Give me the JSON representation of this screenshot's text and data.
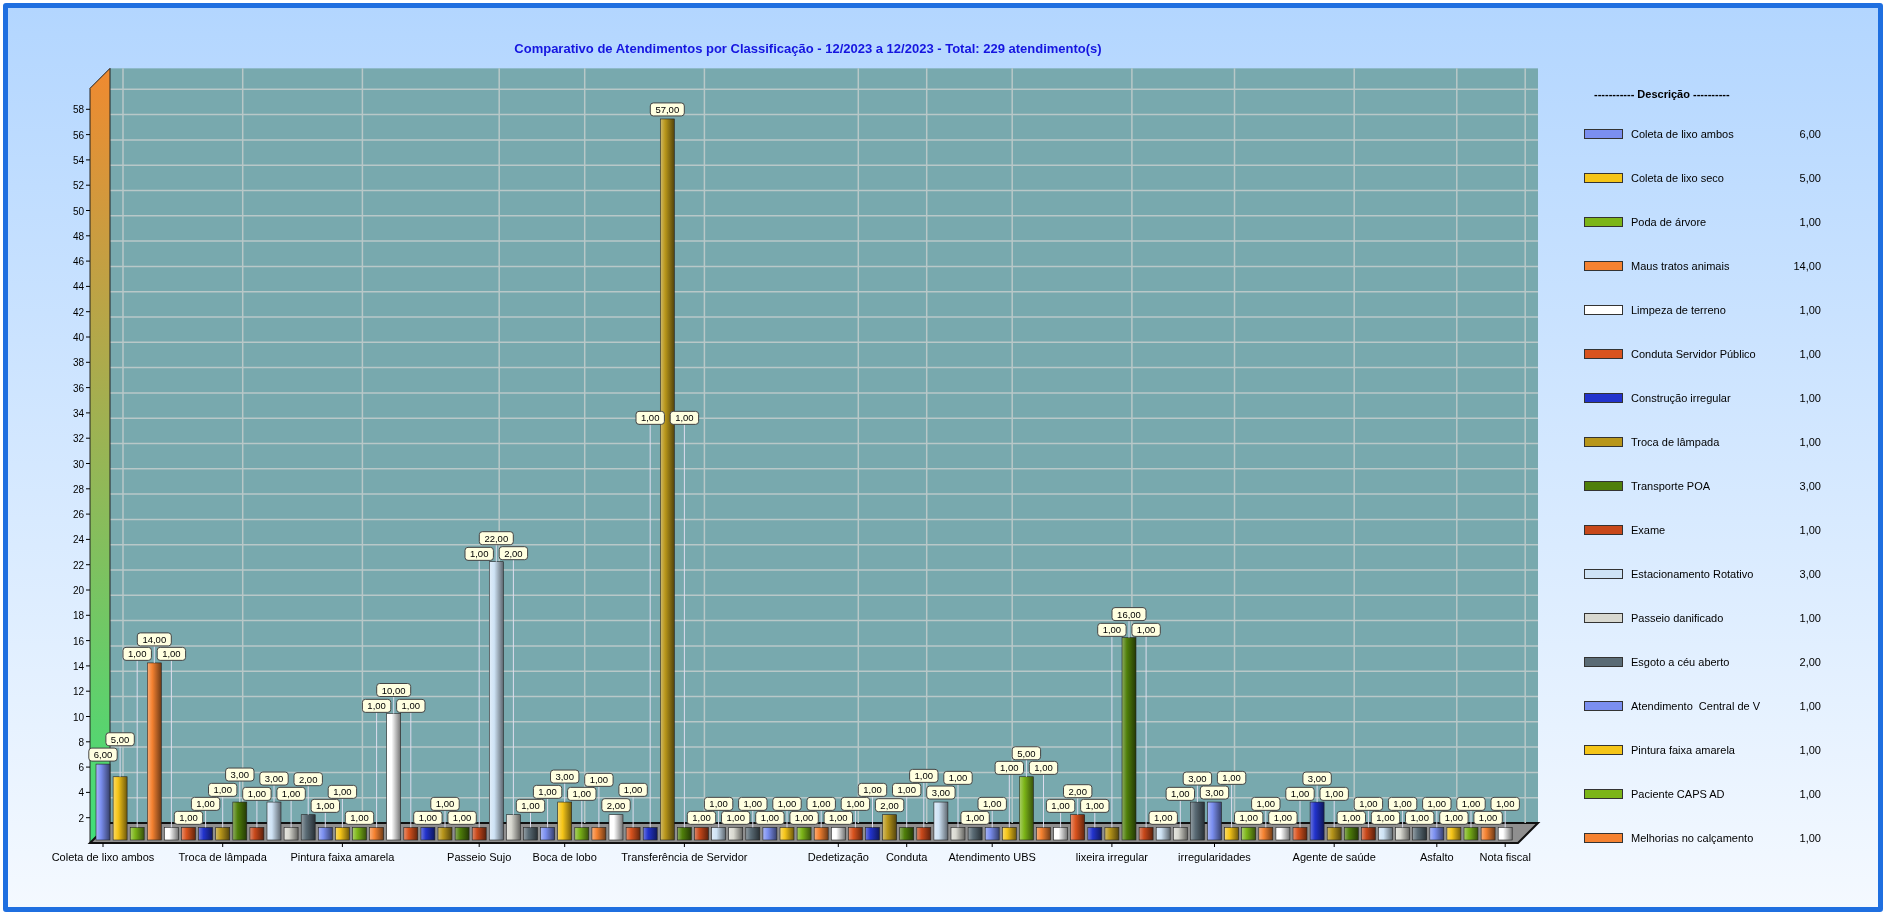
{
  "chart": {
    "chart_data": {
      "type": "bar",
      "title": "Comparativo de Atendimentos por Classificação - 12/2023 a 12/2023 - Total: 229 atendimento(s)",
      "categories": [
        "Coleta de lixo ambos",
        null,
        null,
        null,
        null,
        null,
        null,
        "Troca de lâmpada",
        null,
        null,
        null,
        null,
        null,
        null,
        "Pintura faixa amarela",
        null,
        null,
        null,
        null,
        null,
        null,
        null,
        "Passeio Sujo",
        null,
        null,
        null,
        null,
        "Boca de lobo",
        null,
        null,
        null,
        null,
        null,
        null,
        "Transferência de Servidor",
        null,
        null,
        null,
        null,
        null,
        null,
        null,
        null,
        "Dedetização",
        null,
        null,
        null,
        "Conduta",
        null,
        null,
        null,
        null,
        "Atendimento UBS",
        null,
        null,
        null,
        null,
        null,
        null,
        "lixeira irregular",
        null,
        null,
        null,
        null,
        null,
        "irregularidades",
        null,
        null,
        null,
        null,
        null,
        null,
        "Agente de saúde",
        null,
        null,
        null,
        null,
        null,
        "Asfalto",
        null,
        null,
        null,
        "Nota fiscal"
      ],
      "series": [
        {
          "values": [
            6,
            5,
            1,
            14,
            1,
            1,
            1,
            1,
            3,
            1,
            3,
            1,
            2,
            1,
            1,
            1,
            1,
            10,
            1,
            1,
            1,
            1,
            1,
            22,
            2,
            1,
            1,
            3,
            1,
            1,
            2,
            1,
            1,
            57,
            1,
            1,
            1,
            1,
            1,
            1,
            1,
            1,
            1,
            1,
            1,
            1,
            2,
            1,
            1,
            3,
            1,
            1,
            1,
            1,
            5,
            1,
            1,
            2,
            1,
            1,
            16,
            1,
            1,
            1,
            3,
            3,
            1,
            1,
            1,
            1,
            1,
            3,
            1,
            1,
            1,
            1,
            1,
            1,
            1,
            1,
            1,
            1,
            1
          ]
        }
      ],
      "value_labels": [
        "6,00",
        "5,00",
        "1,00",
        "14,00",
        "1,00",
        "1,00",
        "1,00",
        "1,00",
        "3,00",
        "1,00",
        "3,00",
        "1,00",
        "2,00",
        "1,00",
        "1,00",
        "1,00",
        "1,00",
        "10,00",
        "1,00",
        "1,00",
        "1,00",
        "1,00",
        "1,00",
        "22,00",
        "2,00",
        "1,00",
        "1,00",
        "3,00",
        "1,00",
        "1,00",
        "2,00",
        "1,00",
        "1,00",
        "57,00",
        "1,00",
        "1,00",
        "1,00",
        "1,00",
        "1,00",
        "1,00",
        "1,00",
        "1,00",
        "1,00",
        "1,00",
        "1,00",
        "1,00",
        "2,00",
        "1,00",
        "1,00",
        "3,00",
        "1,00",
        "1,00",
        "1,00",
        "1,00",
        "5,00",
        "1,00",
        "1,00",
        "2,00",
        "1,00",
        "1,00",
        "16,00",
        "1,00",
        "1,00",
        "1,00",
        "3,00",
        "3,00",
        "1,00",
        "1,00",
        "1,00",
        "1,00",
        "1,00",
        "3,00",
        "1,00",
        "1,00",
        "1,00",
        "1,00",
        "1,00",
        "1,00",
        "1,00",
        "1,00",
        "1,00",
        "1,00",
        "1,00"
      ],
      "ylim": [
        0,
        61
      ],
      "yticks": [
        2,
        4,
        6,
        8,
        10,
        12,
        14,
        16,
        18,
        20,
        22,
        24,
        26,
        28,
        30,
        32,
        34,
        36,
        38,
        40,
        42,
        44,
        46,
        48,
        50,
        52,
        54,
        56,
        58
      ]
    }
  },
  "legend": {
    "title": "----------- Descrição ----------",
    "items": [
      {
        "label": "Coleta de lixo ambos",
        "value": "6,00",
        "color": "#7b8ff0"
      },
      {
        "label": "Coleta de lixo seco",
        "value": "5,00",
        "color": "#f5c518"
      },
      {
        "label": "Poda de árvore",
        "value": "1,00",
        "color": "#7cb518"
      },
      {
        "label": "Maus tratos animais",
        "value": "14,00",
        "color": "#f58231"
      },
      {
        "label": "Limpeza de terreno",
        "value": "1,00",
        "color": "#ffffff"
      },
      {
        "label": "Conduta Servidor Público",
        "value": "1,00",
        "color": "#d9531e"
      },
      {
        "label": "Construção irregular",
        "value": "1,00",
        "color": "#2233cc"
      },
      {
        "label": "Troca de lâmpada",
        "value": "1,00",
        "color": "#b8961a"
      },
      {
        "label": "Transporte POA",
        "value": "3,00",
        "color": "#4f7f0a"
      },
      {
        "label": "Exame",
        "value": "1,00",
        "color": "#c8481a"
      },
      {
        "label": "Estacionamento Rotativo",
        "value": "3,00",
        "color": "#cfe3f5"
      },
      {
        "label": "Passeio danificado",
        "value": "1,00",
        "color": "#d8d8d0"
      },
      {
        "label": "Esgoto a céu aberto",
        "value": "2,00",
        "color": "#5a6b75"
      },
      {
        "label": "Atendimento  Central de V",
        "value": "1,00",
        "color": "#7b8ff0"
      },
      {
        "label": "Pintura faixa amarela",
        "value": "1,00",
        "color": "#f5c518"
      },
      {
        "label": "Paciente CAPS AD",
        "value": "1,00",
        "color": "#7cb518"
      },
      {
        "label": "Melhorias no calçamento",
        "value": "1,00",
        "color": "#f58231"
      }
    ]
  }
}
